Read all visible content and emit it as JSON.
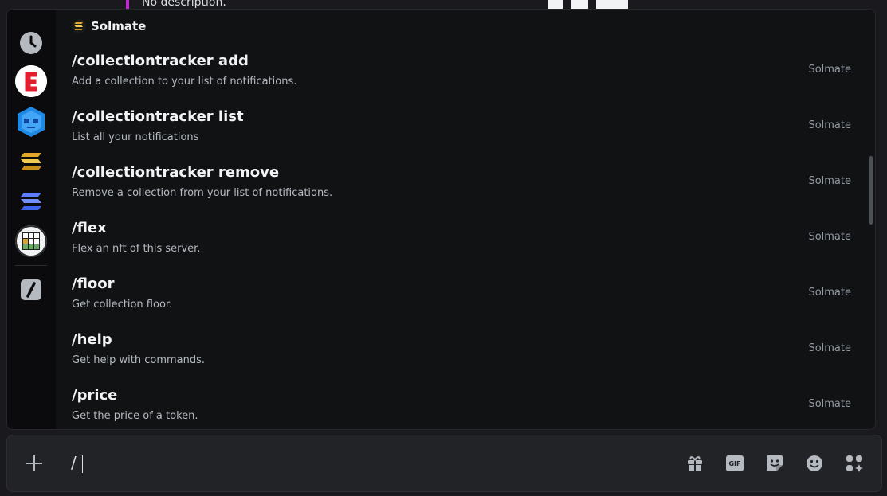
{
  "background": {
    "preview_text": "No description."
  },
  "rail": {
    "items": [
      {
        "icon": "clock-icon"
      },
      {
        "icon": "e-app-icon"
      },
      {
        "icon": "blue-robot-icon"
      },
      {
        "icon": "solana-gold-icon"
      },
      {
        "icon": "solana-blue-icon"
      },
      {
        "icon": "grid-app-icon"
      },
      {
        "icon": "slash-command-icon"
      }
    ]
  },
  "section": {
    "name": "Solmate",
    "icon": "solmate-icon"
  },
  "commands": [
    {
      "name": "/collectiontracker add",
      "description": "Add a collection to your list of notifications.",
      "source": "Solmate"
    },
    {
      "name": "/collectiontracker list",
      "description": "List all your notifications",
      "source": "Solmate"
    },
    {
      "name": "/collectiontracker remove",
      "description": "Remove a collection from your list of notifications.",
      "source": "Solmate"
    },
    {
      "name": "/flex",
      "description": "Flex an nft of this server.",
      "source": "Solmate"
    },
    {
      "name": "/floor",
      "description": "Get collection floor.",
      "source": "Solmate"
    },
    {
      "name": "/help",
      "description": "Get help with commands.",
      "source": "Solmate"
    },
    {
      "name": "/price",
      "description": "Get the price of a token.",
      "source": "Solmate"
    }
  ],
  "composer": {
    "value": "/",
    "tools": [
      "gift-icon",
      "gif-icon",
      "sticker-icon",
      "emoji-icon",
      "apps-icon"
    ],
    "gif_label": "GIF"
  },
  "colors": {
    "accent_bar": "#c026d3",
    "popup_bg": "#111214",
    "rail_bg": "#0b0b0d"
  }
}
